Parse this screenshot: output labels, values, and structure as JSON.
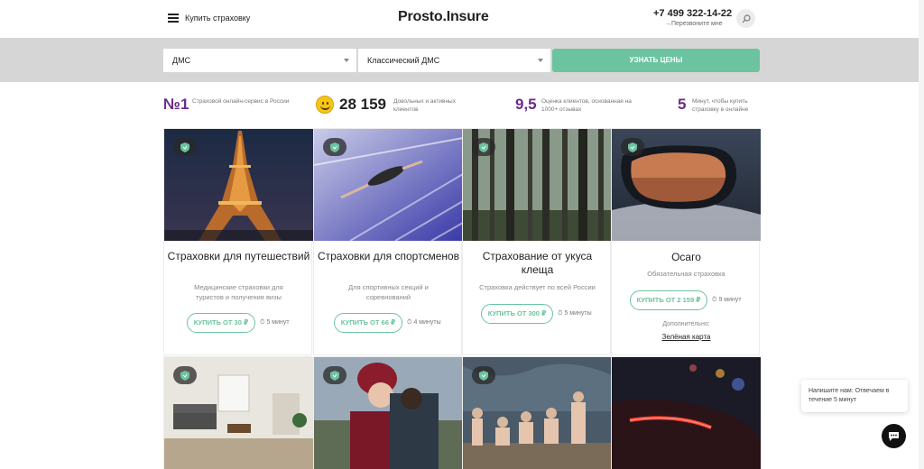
{
  "header": {
    "menu_label": "Купить страховку",
    "logo": "Prosto.Insure",
    "phone": "+7 499 322-14-22",
    "callback": "Перезвоните мне",
    "search_icon": "search-icon"
  },
  "form": {
    "select1": "ДМС",
    "select2": "Классический ДМС",
    "cta": "УЗНАТЬ ЦЕНЫ",
    "accent": "#6cc3a0"
  },
  "stats": [
    {
      "big": "№1",
      "text": "Страховой онлайн-сервис в России"
    },
    {
      "big": "28 159",
      "text": "Довольных и активных клиентов"
    },
    {
      "big": "9,5",
      "text": "Оценка клиентов, основанная на 1000+ отзывах"
    },
    {
      "big": "5",
      "text": "Минут, чтобы купить страховку в онлайне"
    }
  ],
  "cards": [
    {
      "title": "Страховки для путешествий",
      "desc": "Медицинские страховки для туристов и получения визы",
      "buy": "КУПИТЬ ОТ 30 ₽",
      "time": "5 минут"
    },
    {
      "title": "Страховки для спортсменов",
      "desc": "Для спортивных секций и соревнований",
      "buy": "КУПИТЬ ОТ 66 ₽",
      "time": "4 минуты"
    },
    {
      "title": "Страхование от укуса клеща",
      "desc": "Страховка действует по всей России",
      "buy": "КУПИТЬ ОТ 300 ₽",
      "time": "5 минуты"
    },
    {
      "title": "Осаго",
      "desc": "Обязательная страховка",
      "buy": "КУПИТЬ ОТ 2 159 ₽",
      "time": "9 минут",
      "extra_label": "Дополнительно:",
      "extra_link": "Зелёная карта"
    }
  ],
  "chat": {
    "text": "Напишите нам: Отвечаем в течение 5 минут"
  }
}
